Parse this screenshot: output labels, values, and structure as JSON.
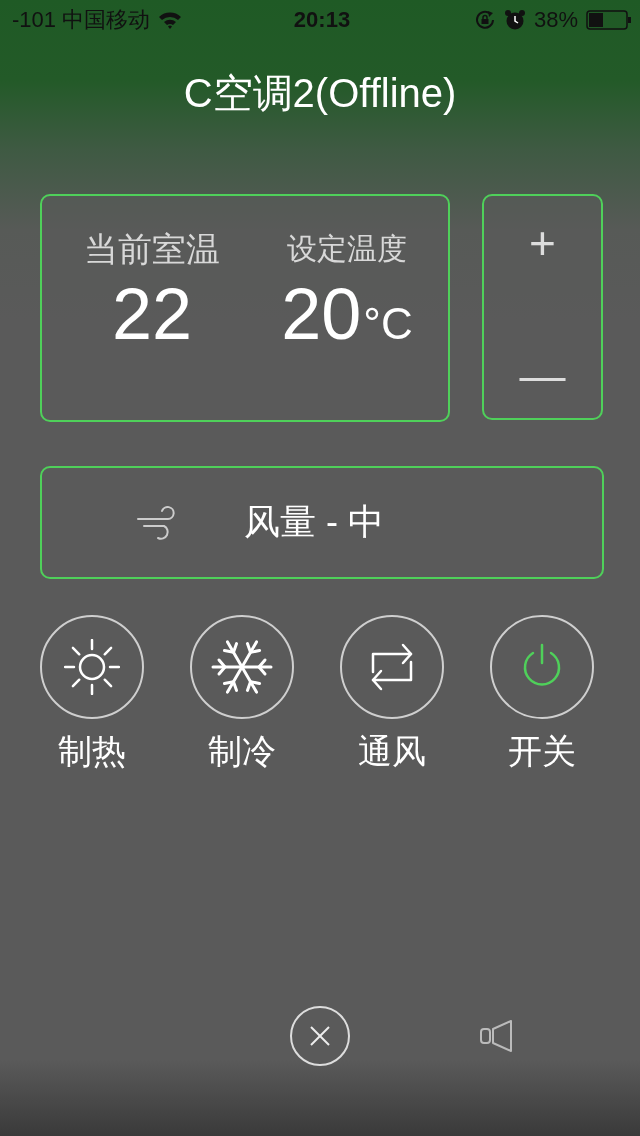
{
  "status_bar": {
    "carrier": "-101 中国移动",
    "time": "20:13",
    "battery": "38%"
  },
  "title": "C空调2(Offline)",
  "temperature": {
    "current_label": "当前室温",
    "current_value": "22",
    "set_label": "设定温度",
    "set_value": "20",
    "unit": "°C"
  },
  "adjust": {
    "plus": "+",
    "minus": "—"
  },
  "fan": {
    "label": "风量 - 中"
  },
  "modes": [
    {
      "kind": "heat",
      "label": "制热",
      "on": false
    },
    {
      "kind": "cool",
      "label": "制冷",
      "on": false
    },
    {
      "kind": "fan",
      "label": "通风",
      "on": false
    },
    {
      "kind": "power",
      "label": "开关",
      "on": true
    }
  ]
}
